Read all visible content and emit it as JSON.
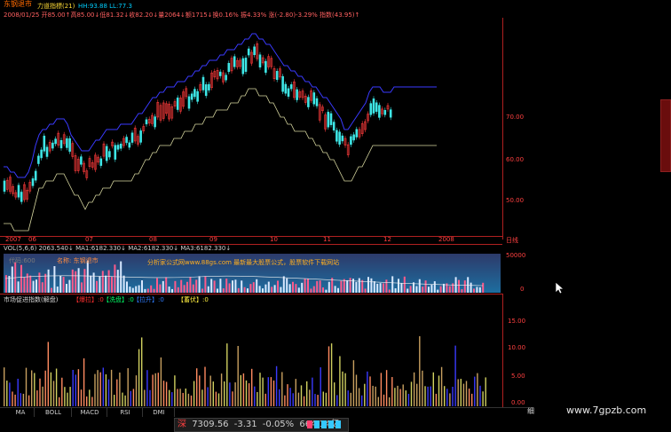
{
  "header": {
    "stock_name": "东钢退市",
    "indicator_name": "力道指標(21)",
    "indicator_values": "HH:93.88  LL:77.3",
    "quote": "2008/01/25  开85.00↑高85.00↓低81.32↓收82.20↓量2064↓额1715↓换0.16%  振4.33%  涨(-2.80)-3.29%  指数(43.95)↑"
  },
  "price_axis": {
    "ticks": [
      "70.00",
      "60.00",
      "50.00"
    ]
  },
  "date_axis": {
    "labels": [
      "2007",
      "06",
      "07",
      "08",
      "09",
      "10",
      "11",
      "12",
      "2008"
    ],
    "period": "日线"
  },
  "volume_panel": {
    "header": "VOL(5,6,6)  2063.540↓  MA1:6182.330↓  MA2:6182.330↓  MA3:6182.330↓",
    "axis_ticks": [
      "50000",
      "0"
    ],
    "watermark_left": "代码:600",
    "watermark_name": "名称: 东钢退市",
    "ad_text": "分析家公式网www.88gs.com  最新最大股票公式，股票软件下载网站"
  },
  "market_panel": {
    "title": "市场促进指数(解盘)",
    "legend": [
      {
        "label": "【爆拉】:0",
        "color": "#ff3030"
      },
      {
        "label": "【洗盘】:0",
        "color": "#00ff66"
      },
      {
        "label": "【拉升】:0",
        "color": "#2f7dff"
      },
      {
        "label": "【蓄伏】:0",
        "color": "#ffef40"
      }
    ],
    "axis_ticks": [
      "15.00",
      "10.00",
      "5.00",
      "0.00"
    ]
  },
  "tabs": [
    "MA",
    "BOLL",
    "MACD",
    "RSI",
    "DMI"
  ],
  "status_bar": {
    "index_name": "深",
    "value": "7309.56",
    "change": "-3.31",
    "change_pct": "-0.05%",
    "turnover": "664.14亿"
  },
  "corner_label": "细",
  "watermark": "www.7gpzb.com",
  "colors": {
    "up": "#ff3b3b",
    "down": "#3ee6e6",
    "stop_line": "#d8d8a0",
    "trend_line": "#3a3aff",
    "axis": "#b02020"
  }
}
